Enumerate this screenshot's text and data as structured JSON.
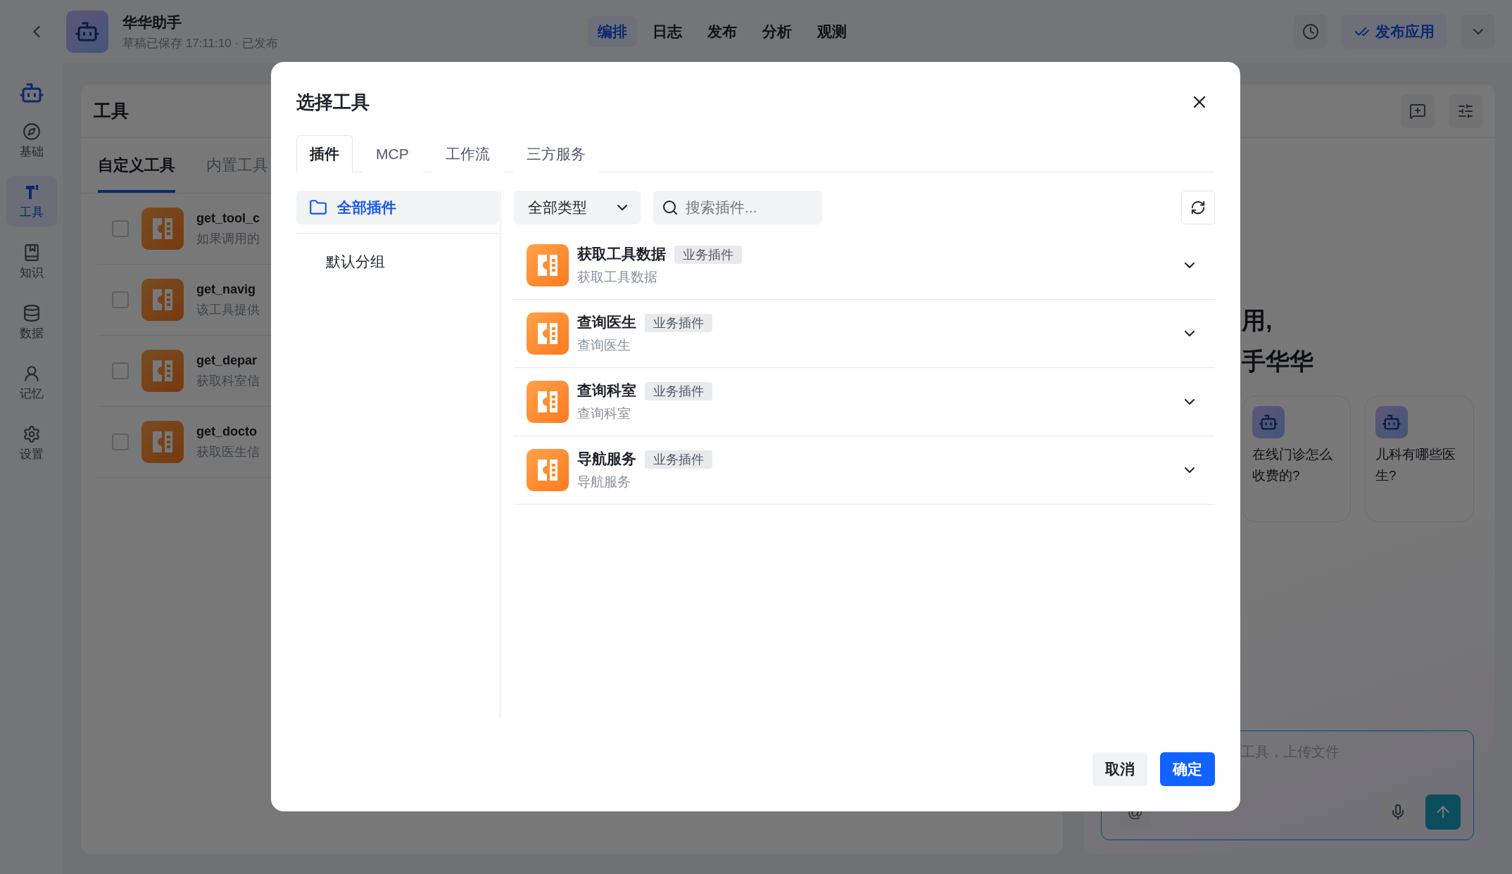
{
  "app": {
    "title": "华华助手",
    "status": "草稿已保存 17:11:10 · 已发布"
  },
  "nav_tabs": [
    {
      "label": "编排",
      "selected": true
    },
    {
      "label": "日志",
      "selected": false
    },
    {
      "label": "发布",
      "selected": false
    },
    {
      "label": "分析",
      "selected": false
    },
    {
      "label": "观测",
      "selected": false
    }
  ],
  "publish_button": "发布应用",
  "rail": [
    {
      "label": "基础",
      "kind": "compass",
      "selected": false
    },
    {
      "label": "工具",
      "kind": "tool",
      "selected": true
    },
    {
      "label": "知识",
      "kind": "book",
      "selected": false
    },
    {
      "label": "数据",
      "kind": "database",
      "selected": false
    },
    {
      "label": "记忆",
      "kind": "memory",
      "selected": false
    },
    {
      "label": "设置",
      "kind": "gear",
      "selected": false
    }
  ],
  "tools_panel": {
    "title": "工具",
    "tabs": [
      {
        "label": "自定义工具",
        "selected": true
      },
      {
        "label": "内置工具",
        "selected": false
      }
    ],
    "items": [
      {
        "name": "get_tool_c",
        "description": "如果调用的",
        "checked": false
      },
      {
        "name": "get_navig",
        "description": "该工具提供",
        "checked": false
      },
      {
        "name": "get_depar",
        "description": "获取科室信",
        "checked": false
      },
      {
        "name": "get_docto",
        "description": "获取医生信",
        "checked": false
      }
    ]
  },
  "chat": {
    "greeting_lines": [
      "用,",
      "手华华"
    ],
    "suggestions": [
      "在线门诊怎么收费的?",
      "儿科有哪些医生?"
    ],
    "input_placeholder": "工具，上传文件",
    "mention_symbol": "@"
  },
  "dialog": {
    "title": "选择工具",
    "tabs": [
      {
        "label": "插件",
        "selected": true
      },
      {
        "label": "MCP",
        "selected": false
      },
      {
        "label": "工作流",
        "selected": false
      },
      {
        "label": "三方服务",
        "selected": false
      }
    ],
    "groups": [
      {
        "label": "全部插件",
        "selected": true
      },
      {
        "label": "默认分组",
        "selected": false
      }
    ],
    "type_filter": "全部类型",
    "search_placeholder": "搜索插件...",
    "plugins": [
      {
        "name": "获取工具数据",
        "tag": "业务插件",
        "description": "获取工具数据"
      },
      {
        "name": "查询医生",
        "tag": "业务插件",
        "description": "查询医生"
      },
      {
        "name": "查询科室",
        "tag": "业务插件",
        "description": "查询科室"
      },
      {
        "name": "导航服务",
        "tag": "业务插件",
        "description": "导航服务"
      }
    ],
    "cancel_button": "取消",
    "confirm_button": "确定"
  }
}
